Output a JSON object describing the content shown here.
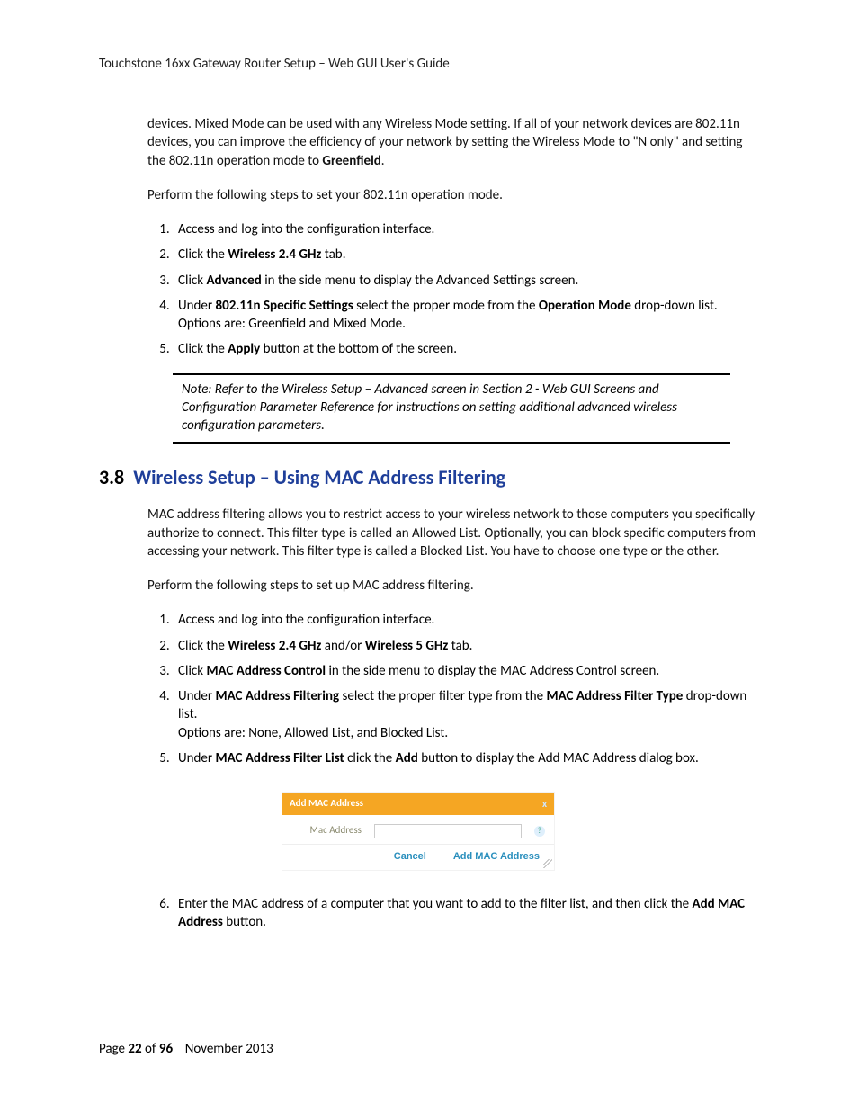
{
  "header": {
    "running_title": "Touchstone 16xx Gateway Router Setup – Web GUI User's Guide"
  },
  "intro": {
    "p1_prefix": "devices.  Mixed Mode can be used with any Wireless Mode setting.  If all of your network devices are 802.11n devices, you can improve the efficiency of your network by setting the Wireless Mode to \"N only\" and setting the 802.11n operation mode to ",
    "p1_bold": "Greenfield",
    "p1_suffix": ".",
    "p2": "Perform the following steps to set your 802.11n operation mode."
  },
  "steps1": {
    "s1": "Access and log into the configuration interface.",
    "s2_a": "Click the ",
    "s2_b": "Wireless 2.4 GHz",
    "s2_c": " tab.",
    "s3_a": "Click ",
    "s3_b": "Advanced",
    "s3_c": " in the side menu to display the Advanced Settings screen.",
    "s4_a": "Under ",
    "s4_b": "802.11n Specific Settings",
    "s4_c": " select the proper mode from the ",
    "s4_d": "Operation Mode",
    "s4_e": " drop-down list.",
    "s4_opts": "Options are:  Greenfield and Mixed Mode.",
    "s5_a": "Click the ",
    "s5_b": "Apply",
    "s5_c": " button at the bottom of the screen."
  },
  "note1": "Note:  Refer to the Wireless Setup – Advanced screen in Section 2 - Web GUI Screens and Configuration Parameter Reference for  instructions on setting additional advanced wireless configuration parameters.",
  "section38": {
    "number": "3.8",
    "title": "Wireless Setup – Using MAC Address Filtering"
  },
  "mac": {
    "p1": "MAC address filtering allows you to restrict access to your wireless network to those computers you specifically authorize to connect.  This filter type is called an Allowed List.  Optionally, you can block specific computers from accessing your network.  This filter type is called a Blocked List.  You have to choose one type or the other.",
    "p2": "Perform the following steps to set up MAC address filtering."
  },
  "steps2": {
    "s1": "Access and log into the configuration interface.",
    "s2_a": "Click the ",
    "s2_b": "Wireless 2.4 GHz",
    "s2_c": " and/or ",
    "s2_d": "Wireless 5 GHz",
    "s2_e": " tab.",
    "s3_a": "Click ",
    "s3_b": "MAC Address Control",
    "s3_c": " in the side menu to display the MAC Address Control screen.",
    "s4_a": "Under ",
    "s4_b": "MAC Address Filtering",
    "s4_c": " select the proper filter type from the ",
    "s4_d": "MAC Address Filter Type",
    "s4_e": " drop-down list.",
    "s4_opts": "Options are:  None, Allowed List, and Blocked List.",
    "s5_a": "Under ",
    "s5_b": "MAC Address Filter List",
    "s5_c": " click the ",
    "s5_d": "Add",
    "s5_e": " button to display the Add MAC Address dialog box.",
    "s6_a": "Enter the MAC address of a computer that you want to add to the filter list, and then click the ",
    "s6_b": "Add MAC Address",
    "s6_c": " button."
  },
  "dialog": {
    "title": "Add MAC Address",
    "close": "x",
    "label": "Mac Address",
    "input_value": "",
    "help_glyph": "?",
    "cancel": "Cancel",
    "submit": "Add MAC Address"
  },
  "footer": {
    "a": "Page ",
    "b": "22",
    "c": " of ",
    "d": "96",
    "e": "    November 2013"
  }
}
